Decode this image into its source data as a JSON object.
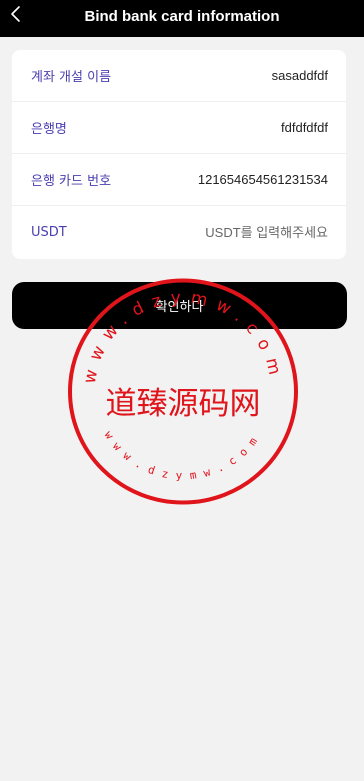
{
  "header": {
    "title": "Bind bank card information",
    "back_icon": "chevron-left-icon"
  },
  "form": {
    "rows": [
      {
        "label": "계좌 개설 이름",
        "value": "sasaddfdf"
      },
      {
        "label": "은행명",
        "value": "fdfdfdfdf"
      },
      {
        "label": "은행 카드 번호",
        "value": "121654654561231534"
      },
      {
        "label": "USDT",
        "value": "",
        "placeholder": "USDT를 입력해주세요"
      }
    ]
  },
  "confirm_button": {
    "label": "확인하다"
  },
  "watermark": {
    "center_text": "道臻源码网",
    "top_text": "www.dzymw.com",
    "bottom_text": "www.dzymw.com",
    "color": "#e0141b"
  },
  "colors": {
    "header_bg": "#000000",
    "page_bg": "#f2f2f2",
    "label": "#4a3fb0",
    "button_bg": "#000000"
  }
}
